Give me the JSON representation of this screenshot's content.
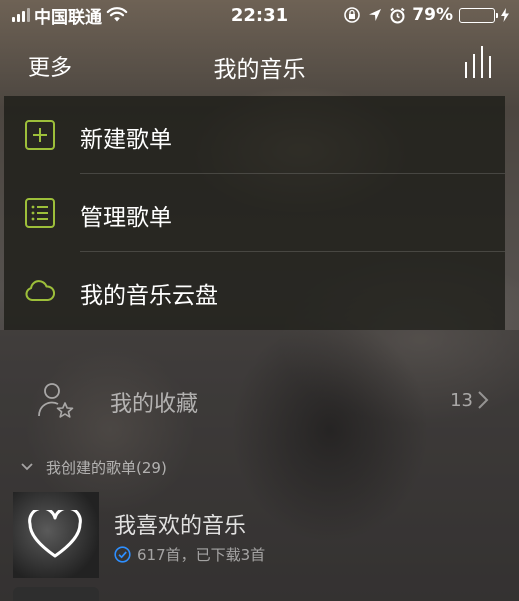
{
  "status_bar": {
    "carrier": "中国联通",
    "time": "22:31",
    "battery": "79%",
    "battery_level": 0.79
  },
  "nav": {
    "left_button": "更多",
    "title": "我的音乐",
    "right_icon": "equalizer-icon"
  },
  "menu": {
    "items": [
      {
        "label": "新建歌单",
        "icon": "plus-square-icon"
      },
      {
        "label": "管理歌单",
        "icon": "list-icon"
      },
      {
        "label": "我的音乐云盘",
        "icon": "cloud-icon"
      }
    ]
  },
  "favorites": {
    "label": "我的收藏",
    "count": "13",
    "icon": "user-star-icon"
  },
  "created_section": {
    "label": "我创建的歌单(29)"
  },
  "playlists": [
    {
      "name": "我喜欢的音乐",
      "meta": "617首，已下载3首",
      "icon": "heart-icon"
    }
  ],
  "colors": {
    "accent": "#9dbf3a",
    "battery_fill": "#4cd964",
    "check_blue": "#2e8fff"
  }
}
